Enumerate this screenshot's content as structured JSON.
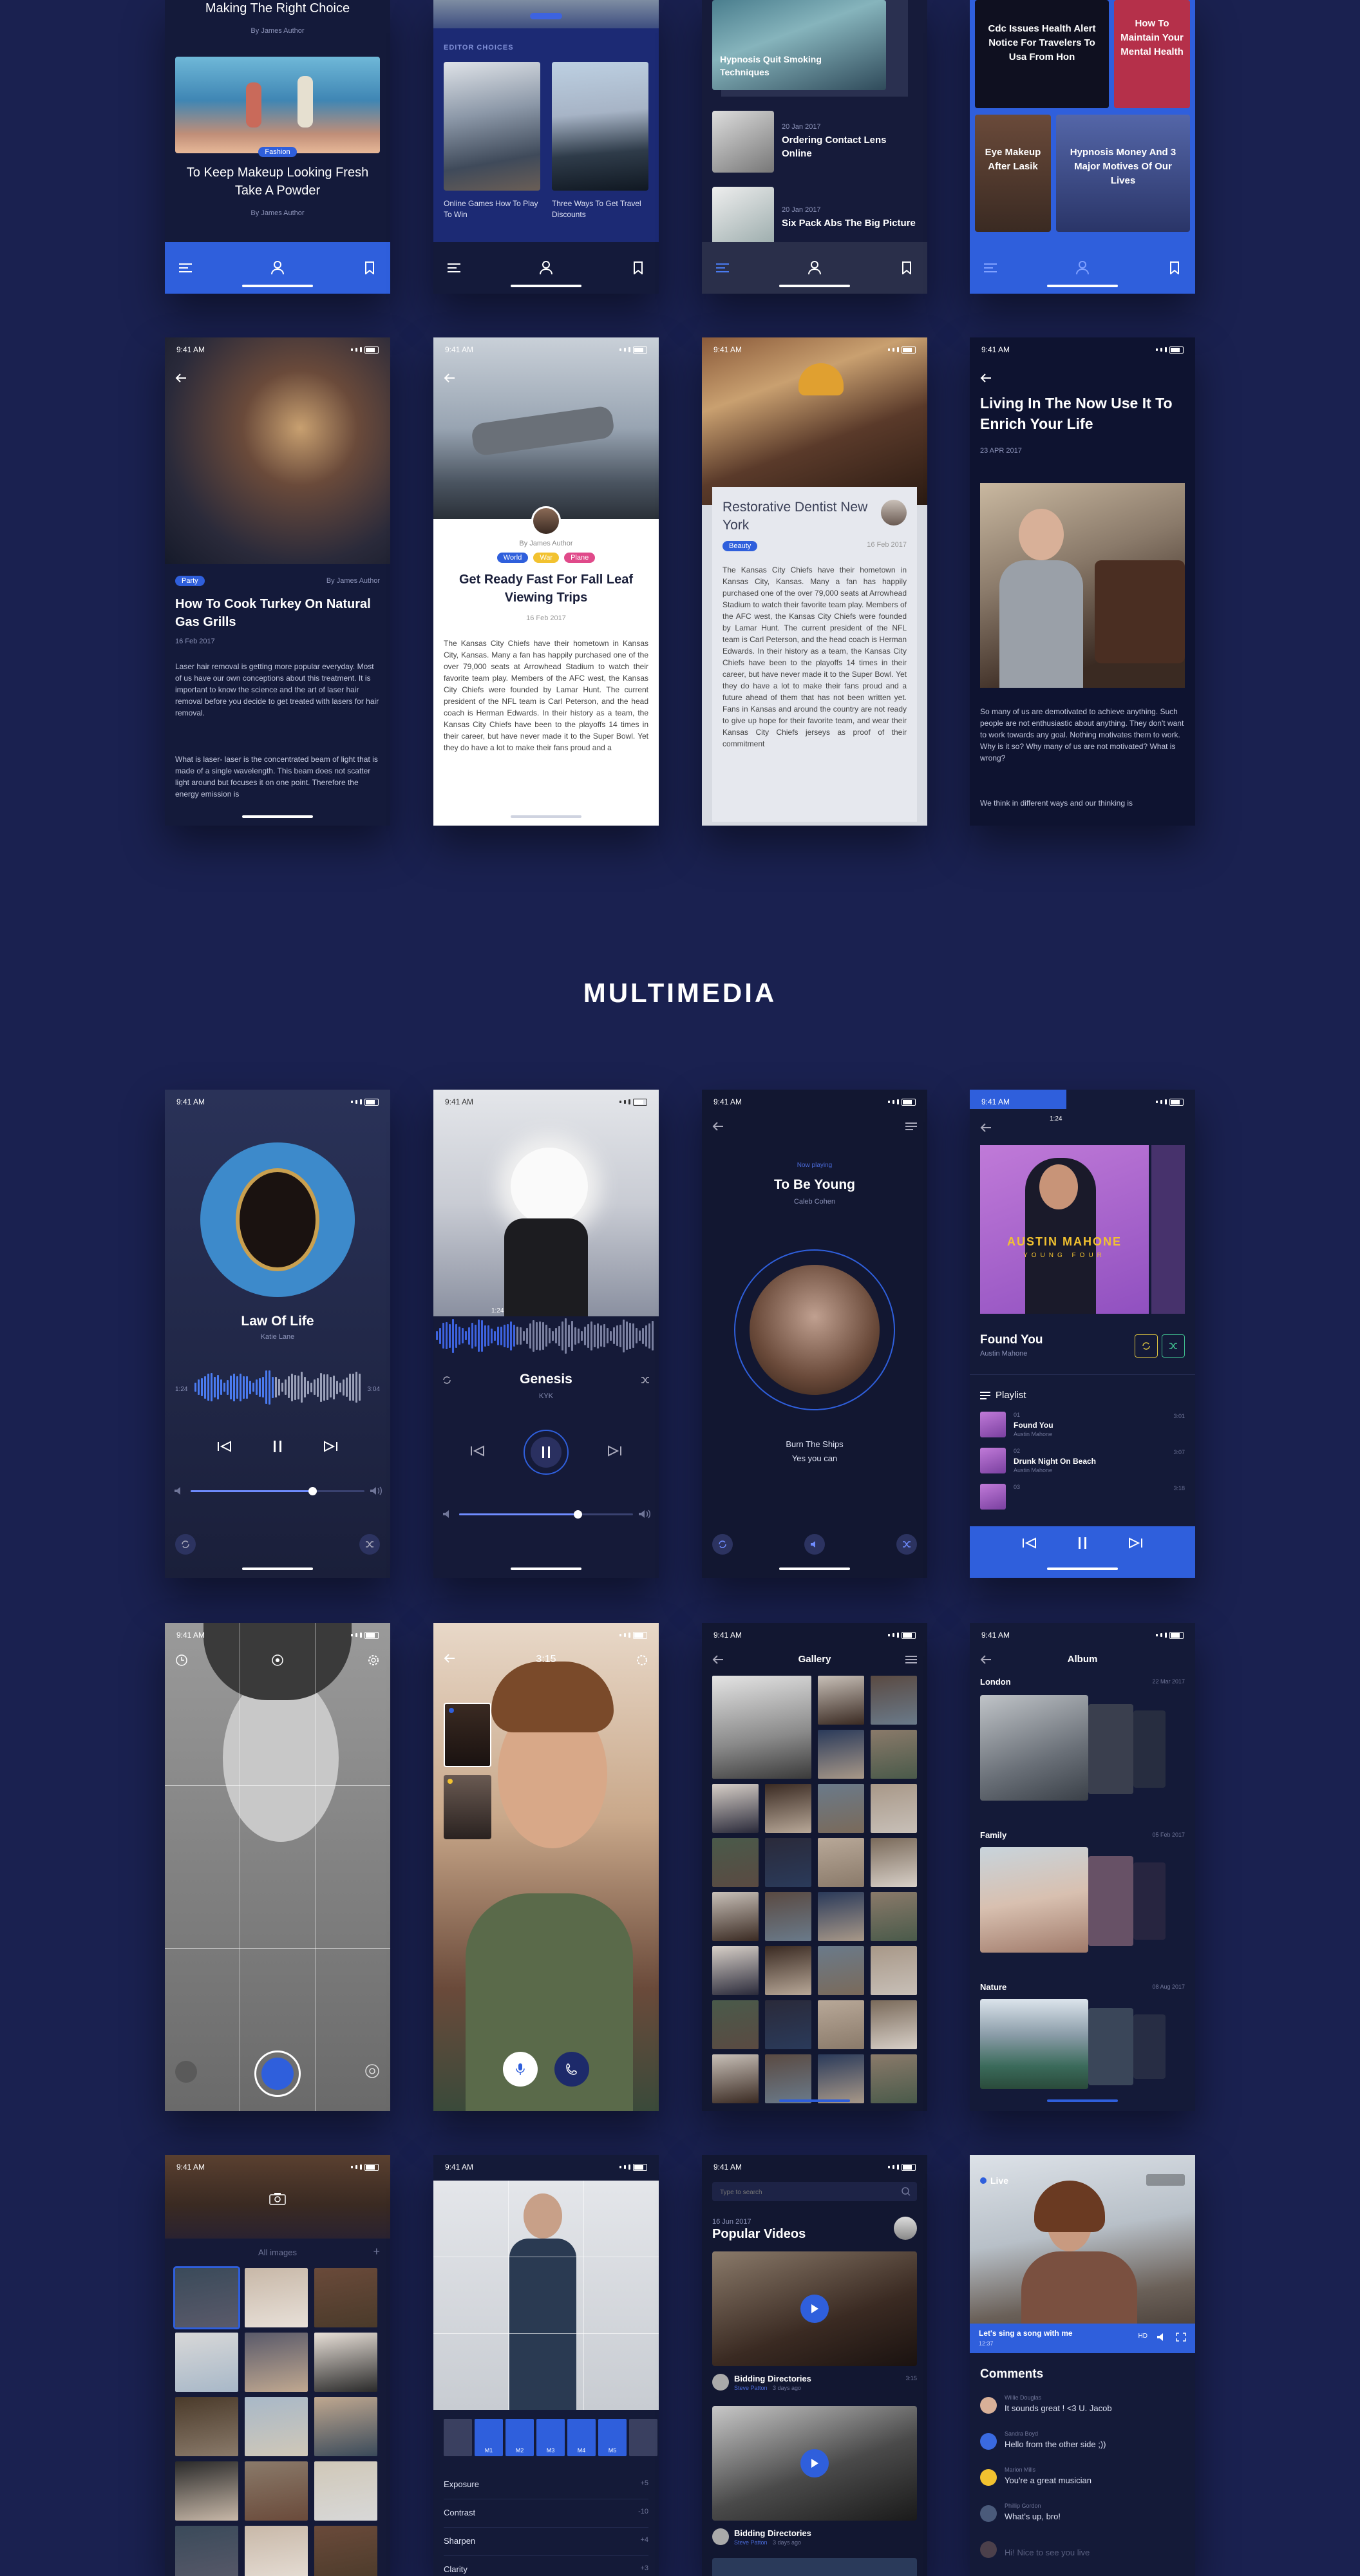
{
  "section_title": "MULTIMEDIA",
  "status_time": "9:41 AM",
  "row0": {
    "p1": {
      "title_top": "Making The Right Choice",
      "byline_top": "By James Author",
      "tag": "Fashion",
      "title": "To Keep Makeup Looking Fresh Take A Powder",
      "byline": "By James Author"
    },
    "p2": {
      "section": "EDITOR CHOICES",
      "card1": "Online Games How To Play To Win",
      "card2": "Three Ways To Get Travel Discounts"
    },
    "p3": {
      "card_title": "Hypnosis Quit Smoking Techniques",
      "item1_date": "20 Jan 2017",
      "item1": "Ordering Contact Lens Online",
      "item2_date": "20 Jan 2017",
      "item2": "Six Pack Abs The Big Picture"
    },
    "p4": {
      "tile1": "Cdc Issues Health Alert Notice For Travelers To Usa From Hon",
      "tile2": "How To Maintain Your Mental Health",
      "tile3": "Eye Makeup After Lasik",
      "tile4": "Hypnosis Money And 3 Major Motives Of Our Lives"
    }
  },
  "row1": {
    "p1": {
      "tag": "Party",
      "author": "By James Author",
      "title": "How To Cook Turkey On Natural Gas Grills",
      "date": "16 Feb 2017",
      "para1": "Laser hair removal is getting more popular everyday. Most of us have our own conceptions about this treatment. It is important to know the science and the art of laser hair removal before you decide to get treated with lasers for hair removal.",
      "para2": "What is laser- laser is the concentrated beam of light that is made of a single wavelength. This beam does not scatter light around but focuses it on one point. Therefore the energy emission is"
    },
    "p2": {
      "author": "By James Author",
      "tags": [
        "World",
        "War",
        "Plane"
      ],
      "title": "Get Ready Fast For Fall Leaf Viewing Trips",
      "date": "16 Feb 2017",
      "para": "The Kansas City Chiefs have their hometown in Kansas City, Kansas. Many a fan has happily purchased one of the over 79,000 seats at Arrowhead Stadium to watch their favorite team play. Members of the AFC west, the Kansas City Chiefs were founded by Lamar Hunt. The current president of the NFL team is Carl Peterson, and the head coach is Herman Edwards. In their history as a team, the Kansas City Chiefs have been to the playoffs 14 times in their career, but have never made it to the Super Bowl. Yet they do have a lot to make their fans proud and a"
    },
    "p3": {
      "title": "Restorative Dentist New York",
      "tag": "Beauty",
      "date": "16 Feb 2017",
      "para": "The Kansas City Chiefs have their hometown in Kansas City, Kansas. Many a fan has happily purchased one of the over 79,000 seats at Arrowhead Stadium to watch their favorite team play. Members of the AFC west, the Kansas City Chiefs were founded by Lamar Hunt. The current president of the NFL team is Carl Peterson, and the head coach is Herman Edwards. In their history as a team, the Kansas City Chiefs have been to the playoffs 14 times in their career, but have never made it to the Super Bowl. Yet they do have a lot to make their fans proud and a future ahead of them that has not been written yet. Fans in Kansas and around the country are not ready to give up hope for their favorite team, and wear their Kansas City Chiefs jerseys as proof of their commitment"
    },
    "p4": {
      "title": "Living In The Now Use It To Enrich Your Life",
      "date": "23 APR 2017",
      "para1": "So many of us are demotivated to achieve anything. Such people are not enthusiastic about anything. They don't want to work towards any goal. Nothing motivates them to work. Why is it so? Why many of us are not motivated? What is wrong?",
      "para2": "We think in different ways and our thinking is"
    }
  },
  "row2": {
    "p1": {
      "title": "Law Of Life",
      "artist": "Katie Lane",
      "t_start": "1:24",
      "t_end": "3:04",
      "progress": 0.7
    },
    "p2": {
      "time_marker": "1:24",
      "title": "Genesis",
      "artist": "KYK",
      "progress": 0.68
    },
    "p3": {
      "label": "Now playing",
      "title": "To Be Young",
      "artist": "Caleb Cohen",
      "lyric1": "Burn The Ships",
      "lyric2": "Yes you can"
    },
    "p4": {
      "time_marker": "1:24",
      "cover_text": "AUSTIN MAHONE",
      "cover_sub": "YOUNG FOUR",
      "title": "Found You",
      "artist": "Austin Mahone",
      "playlist_label": "Playlist",
      "tracks": [
        {
          "num": "01",
          "title": "Found You",
          "artist": "Austin Mahone",
          "time": "3:01"
        },
        {
          "num": "02",
          "title": "Drunk Night On Beach",
          "artist": "Austin Mahone",
          "time": "3:07"
        },
        {
          "num": "03",
          "title": "",
          "artist": "",
          "time": "3:18"
        }
      ]
    }
  },
  "row3": {
    "p2": {
      "timer": "3:15"
    },
    "p3": {
      "title": "Gallery"
    },
    "p4": {
      "title": "Album",
      "albums": [
        {
          "name": "London",
          "date": "22 Mar 2017"
        },
        {
          "name": "Family",
          "date": "05 Feb 2017"
        },
        {
          "name": "Nature",
          "date": "08 Aug 2017"
        }
      ]
    }
  },
  "row4": {
    "p1": {
      "label": "All images"
    },
    "p2": {
      "settings": [
        {
          "name": "Exposure",
          "value": "+5"
        },
        {
          "name": "Contrast",
          "value": "-10"
        },
        {
          "name": "Sharpen",
          "value": "+4"
        },
        {
          "name": "Clarity",
          "value": "+3"
        }
      ],
      "filters": [
        "M1",
        "M2",
        "M3",
        "M4",
        "M5"
      ]
    },
    "p3": {
      "search_placeholder": "Type to search",
      "date": "16 Jun 2017",
      "title": "Popular Videos",
      "video1_title": "Bidding Directories",
      "video1_author": "Steve Patton",
      "video1_meta": "3 days ago",
      "video1_time": "3:15",
      "video2_title": "Bidding Directories",
      "video2_author": "Steve Patton",
      "video2_meta": "3 days ago"
    },
    "p4": {
      "live": "Live",
      "caption": "Let's sing a song with me",
      "caption_time": "12:37",
      "comments_title": "Comments",
      "comments": [
        {
          "author": "Willie Douglas",
          "text": "It sounds great ! <3 U. Jacob"
        },
        {
          "author": "Sandra Boyd",
          "text": "Hello from the other side ;))"
        },
        {
          "author": "Marion Mills",
          "text": "You're a great musician"
        },
        {
          "author": "Phillip Gordon",
          "text": "What's up, bro!"
        },
        {
          "author": "",
          "text": "Hi! Nice to see you live"
        }
      ]
    }
  },
  "colors": {
    "background": "#1a2150",
    "accent": "#2f5fdc",
    "phone_dark": "#141a3a",
    "pink": "#e04a8a",
    "yellow": "#f2c230",
    "blue_tag": "#2f5fdc"
  }
}
